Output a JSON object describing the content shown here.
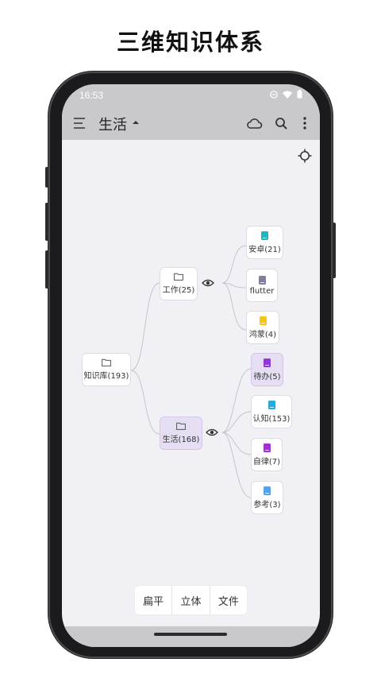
{
  "promo_title": "三维知识体系",
  "status_bar": {
    "time": "16:53"
  },
  "app_bar": {
    "title": "生活"
  },
  "mindmap": {
    "root": {
      "label": "知识库(193)"
    },
    "work": {
      "label": "工作(25)"
    },
    "life": {
      "label": "生活(168)"
    },
    "android": {
      "label": "安卓(21)",
      "color": "#1fb6c4"
    },
    "flutter": {
      "label": "flutter",
      "color": "#7f7e9c"
    },
    "harmony": {
      "label": "鸿蒙(4)",
      "color": "#f5c518"
    },
    "todo": {
      "label": "待办(5)",
      "color": "#8e3ad8"
    },
    "cognition": {
      "label": "认知(153)",
      "color": "#27a8e0"
    },
    "discipline": {
      "label": "自律(7)",
      "color": "#a52fd6"
    },
    "reference": {
      "label": "参考(3)",
      "color": "#52a3e8"
    }
  },
  "view_modes": [
    "扁平",
    "立体",
    "文件"
  ],
  "colors": {
    "accent_selected": "#e6def3",
    "bar_gray": "#c9c8cd",
    "screen_bg": "#f1f0f5"
  }
}
